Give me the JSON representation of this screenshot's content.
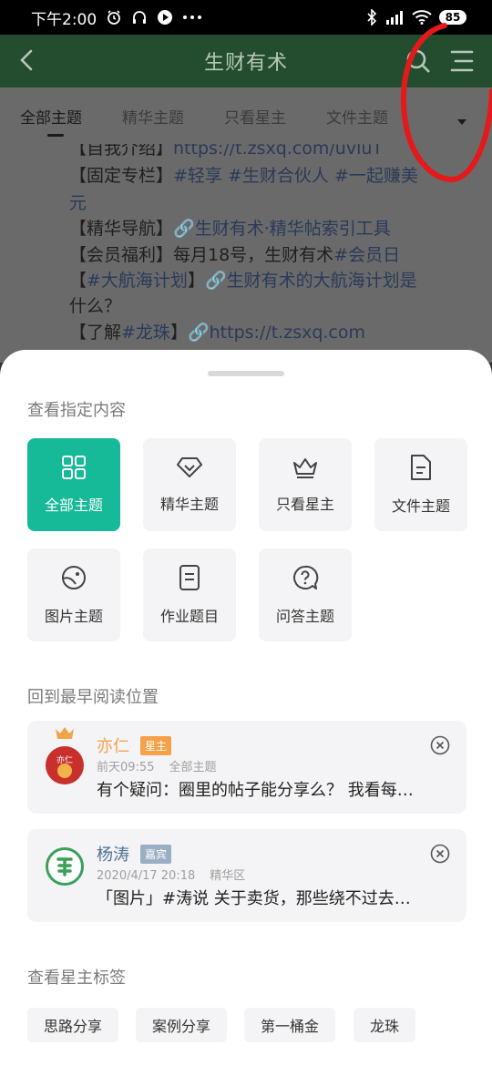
{
  "status_bar": {
    "time": "下午2:00",
    "battery": "85",
    "left_icons": [
      "alarm-icon",
      "headphone-icon",
      "play-icon",
      "more-dots-icon"
    ],
    "right_icons": [
      "bluetooth-icon",
      "signal-icon",
      "wifi-icon",
      "battery-icon"
    ]
  },
  "header": {
    "title": "生财有术",
    "background": "#244d2f"
  },
  "tabs": [
    "全部主题",
    "精华主题",
    "只看星主",
    "文件主题"
  ],
  "background_post": {
    "lines": [
      {
        "prefix": "【固定专栏】",
        "parts": [
          "#轻享",
          "#生财合伙人",
          "#一起赚美"
        ]
      },
      {
        "prefix": "",
        "parts": [
          "元"
        ]
      }
    ],
    "nav_label": "【精华导航】",
    "nav_link": "生财有术·精华帖索引工具",
    "benefit_label": "【会员福利】每月18号，生财有术",
    "benefit_tag": "#会员日",
    "plan_open": "【",
    "plan_tag": "#大航海计划",
    "plan_close": "】",
    "plan_link": "生财有术的大航海计划是",
    "plan_cont": "什么？",
    "learn_label": "【了解",
    "learn_tag": "#龙珠",
    "learn_close": "】",
    "learn_link": "https://t.zsxq.com",
    "top_link": "https://t.zsxq.com/uvluT"
  },
  "sheet": {
    "section1_title": "查看指定内容",
    "filters": [
      {
        "label": "全部主题",
        "icon": "grid-icon",
        "active": true
      },
      {
        "label": "精华主题",
        "icon": "diamond-icon",
        "active": false
      },
      {
        "label": "只看星主",
        "icon": "crown-icon",
        "active": false
      },
      {
        "label": "文件主题",
        "icon": "document-icon",
        "active": false
      },
      {
        "label": "图片主题",
        "icon": "image-icon",
        "active": false
      },
      {
        "label": "作业题目",
        "icon": "assignment-icon",
        "active": false
      },
      {
        "label": "问答主题",
        "icon": "question-icon",
        "active": false
      }
    ],
    "section2_title": "回到最早阅读位置",
    "cards": [
      {
        "name": "亦仁",
        "badge": "星主",
        "time": "前天09:55",
        "category": "全部主题",
        "text": "有个疑问：圈里的帖子能分享么？ 我看每…",
        "name_color": "#f0a44a",
        "badge_color": "#f5a149"
      },
      {
        "name": "杨涛",
        "badge": "嘉宾",
        "time": "2020/4/17 20:18",
        "category": "精华区",
        "text": "「图片」#涛说 关于卖货，那些绕不过去…",
        "name_color": "#4e6f96",
        "badge_color": "#9aaec4"
      }
    ],
    "section3_title": "查看星主标签",
    "tags": [
      "思路分享",
      "案例分享",
      "第一桶金",
      "龙珠"
    ],
    "accent": "#16b998"
  }
}
